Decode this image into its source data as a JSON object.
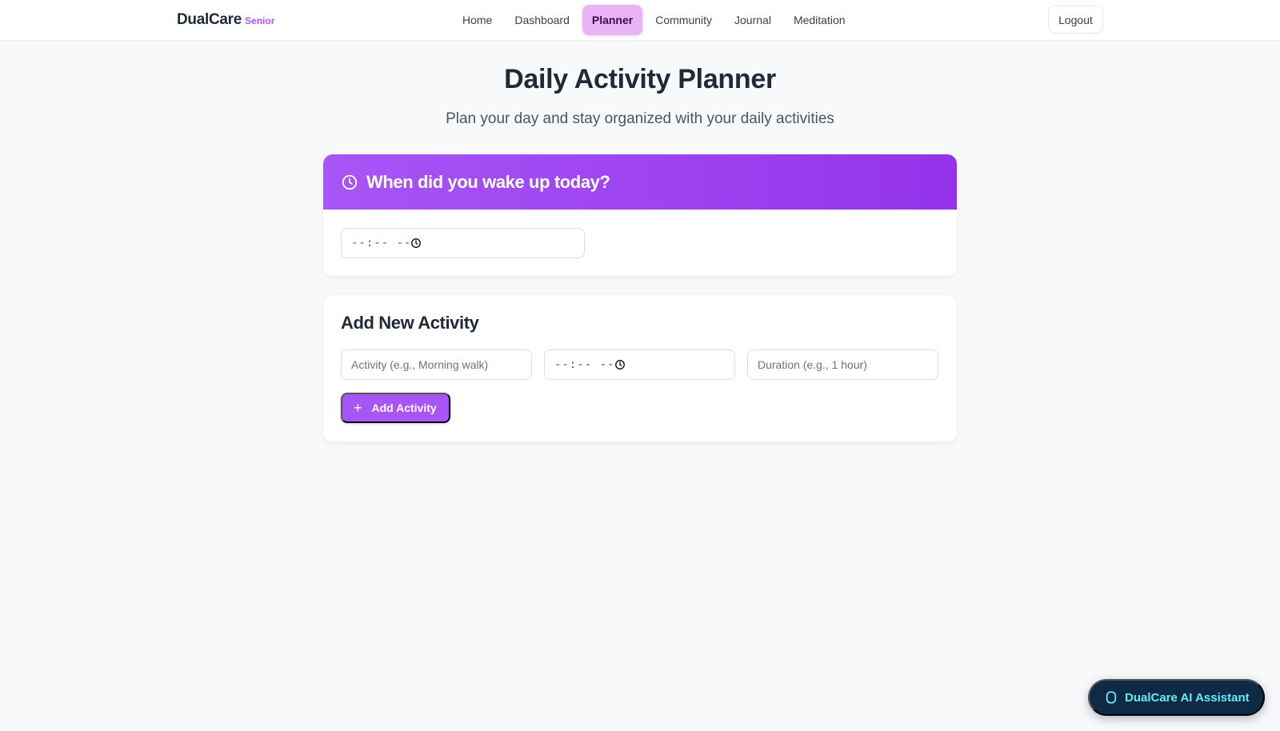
{
  "brand": {
    "name": "DualCare",
    "tag": "Senior"
  },
  "nav": {
    "items": [
      {
        "label": "Home"
      },
      {
        "label": "Dashboard"
      },
      {
        "label": "Planner",
        "active": true
      },
      {
        "label": "Community"
      },
      {
        "label": "Journal"
      },
      {
        "label": "Meditation"
      }
    ],
    "logout_label": "Logout"
  },
  "header": {
    "title": "Daily Activity Planner",
    "subtitle": "Plan your day and stay organized with your daily activities"
  },
  "wake": {
    "title": "When did you wake up today?",
    "time_value": "--:-- --"
  },
  "add_activity": {
    "title": "Add New Activity",
    "activity_placeholder": "Activity (e.g., Morning walk)",
    "time_value": "--:-- --",
    "duration_placeholder": "Duration (e.g., 1 hour)",
    "button_label": "Add Activity"
  },
  "assistant": {
    "label": "DualCare AI Assistant"
  },
  "colors": {
    "accent": "#a855f7",
    "accent_dark": "#9333ea",
    "nav_active_bg": "#e9b4f6",
    "assistant_bg": "#0f2a44",
    "assistant_text": "#67e8f9"
  },
  "icons": {
    "wake_header": "clock-icon",
    "time_input": "clock-icon",
    "add_button": "plus-icon",
    "assistant": "bot-icon"
  }
}
